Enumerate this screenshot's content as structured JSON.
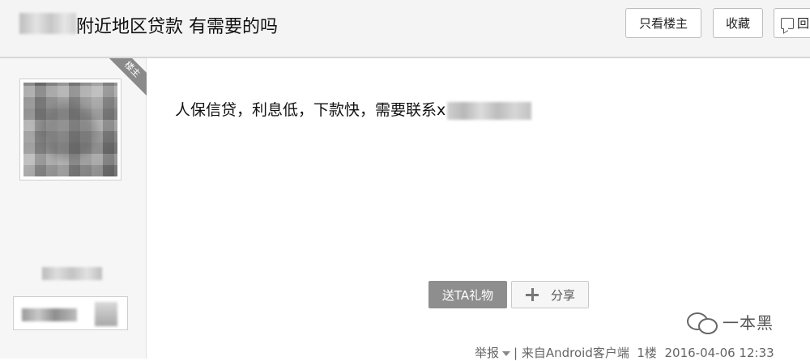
{
  "header": {
    "title": "附近地区贷款 有需要的吗",
    "only_op_label": "只看楼主",
    "collect_label": "收藏",
    "reply_label": "回"
  },
  "sidebar": {
    "op_badge": "楼主"
  },
  "post": {
    "content": "人保信贷，利息低，下款快，需要联系x"
  },
  "actions": {
    "gift_label": "送TA礼物",
    "share_label": "分享"
  },
  "watermark": {
    "text": "一本黑",
    "icon": "wechat-icon"
  },
  "meta": {
    "report_label": "举报",
    "source": "来自Android客户端",
    "floor": "1楼",
    "timestamp": "2016-04-06 12:33"
  }
}
